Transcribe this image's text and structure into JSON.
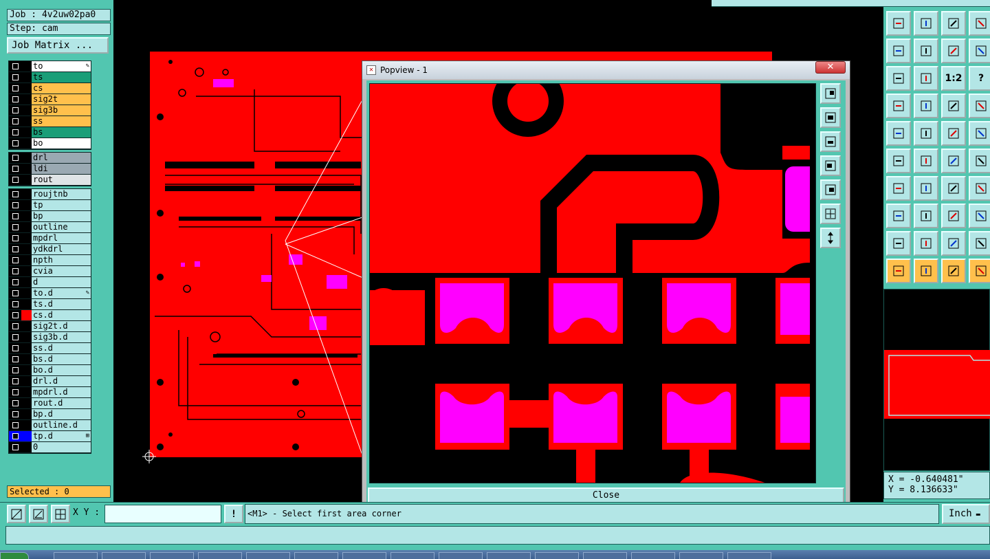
{
  "job": {
    "job_label": "Job : 4v2uw02pa0",
    "step_label": "Step: cam",
    "matrix_button": "Job Matrix ..."
  },
  "layers_board": [
    {
      "name": "to",
      "color": "#ffffff",
      "mark": "✎"
    },
    {
      "name": "ts",
      "color": "#1a9e78",
      "mark": ""
    },
    {
      "name": "cs",
      "color": "#ffc04c",
      "mark": ""
    },
    {
      "name": "sig2t",
      "color": "#ffc04c",
      "mark": ""
    },
    {
      "name": "sig3b",
      "color": "#ffc04c",
      "mark": ""
    },
    {
      "name": "ss",
      "color": "#ffc04c",
      "mark": ""
    },
    {
      "name": "bs",
      "color": "#1a9e78",
      "mark": ""
    },
    {
      "name": "bo",
      "color": "#ffffff",
      "mark": ""
    }
  ],
  "layers_drill": [
    {
      "name": "drl",
      "color": "#9aa9b2"
    },
    {
      "name": "ldi",
      "color": "#9aa9b2"
    },
    {
      "name": "rout",
      "color": "#dfe4e6"
    }
  ],
  "layers_misc": [
    {
      "name": "roujtnb",
      "swatch": "#000000",
      "mark": ""
    },
    {
      "name": "tp",
      "swatch": "#000000",
      "mark": ""
    },
    {
      "name": "bp",
      "swatch": "#000000",
      "mark": ""
    },
    {
      "name": "outline",
      "swatch": "#000000",
      "mark": ""
    },
    {
      "name": "mpdrl",
      "swatch": "#000000",
      "mark": ""
    },
    {
      "name": "ydkdrl",
      "swatch": "#000000",
      "mark": ""
    },
    {
      "name": "npth",
      "swatch": "#000000",
      "mark": ""
    },
    {
      "name": "cvia",
      "swatch": "#000000",
      "mark": ""
    },
    {
      "name": "d",
      "swatch": "#000000",
      "mark": ""
    },
    {
      "name": "to.d",
      "swatch": "#000000",
      "mark": "✎"
    },
    {
      "name": "ts.d",
      "swatch": "#000000",
      "mark": ""
    },
    {
      "name": "cs.d",
      "swatch": "#ff0000",
      "mark": ""
    },
    {
      "name": "sig2t.d",
      "swatch": "#000000",
      "mark": ""
    },
    {
      "name": "sig3b.d",
      "swatch": "#000000",
      "mark": ""
    },
    {
      "name": "ss.d",
      "swatch": "#000000",
      "mark": ""
    },
    {
      "name": "bs.d",
      "swatch": "#000000",
      "mark": ""
    },
    {
      "name": "bo.d",
      "swatch": "#000000",
      "mark": ""
    },
    {
      "name": "drl.d",
      "swatch": "#000000",
      "mark": ""
    },
    {
      "name": "mpdrl.d",
      "swatch": "#000000",
      "mark": ""
    },
    {
      "name": "rout.d",
      "swatch": "#000000",
      "mark": ""
    },
    {
      "name": "bp.d",
      "swatch": "#000000",
      "mark": ""
    },
    {
      "name": "outline.d",
      "swatch": "#000000",
      "mark": ""
    },
    {
      "name": "tp.d",
      "swatch": "#0000ff",
      "mark": "⊞"
    },
    {
      "name": "0",
      "swatch": "#000000",
      "mark": ""
    }
  ],
  "selected": "Selected : 0",
  "popview": {
    "title": "Popview - 1",
    "close_x": "✕",
    "close_button": "Close"
  },
  "toolbar_icons": [
    "layer-up-icon",
    "layer-down-icon",
    "home-icon",
    "window-icon",
    "left-arrow-icon",
    "right-arrow-icon",
    "undo-zoom-icon",
    "redraw-icon",
    "fit-icon",
    "pan-icon",
    "scale-1-2-icon",
    "help-icon",
    "measure-tool-icon",
    "grid-icon",
    "snap-red-icon",
    "snap-blue-icon",
    "pad-icon",
    "line-draw-icon",
    "ruler-icon",
    "dot-icon",
    "net-icon",
    "cross-icon",
    "move-point-icon",
    "add-point-icon",
    "angle-line-icon",
    "slash-line-icon",
    "arc-icon",
    "font-icon",
    "select-box-icon",
    "dash-icon",
    "resize-icon",
    "copy-icon",
    "triangle-icon",
    "triangle-edit-icon",
    "triangle-scale-icon",
    "triangle-arc-icon",
    "pointer-icon",
    "pointer-box-icon",
    "pointer-circle-icon",
    "pointer-node-icon"
  ],
  "toolbar_labels": {
    "scale": "1:2",
    "help": "?"
  },
  "coords": {
    "x": "X = -0.640481\"",
    "y": "Y = 8.136633\""
  },
  "bottom": {
    "xy_label": "X Y :",
    "xy_value": "",
    "exclaim": "!",
    "prompt": "<M1> - Select first area corner",
    "unit": "Inch"
  },
  "colors": {
    "copper": "#ff0000",
    "pad": "#ff00ff",
    "panel": "#52c6b0",
    "field": "#b3e6e6",
    "highlight": "#ffc04c"
  }
}
